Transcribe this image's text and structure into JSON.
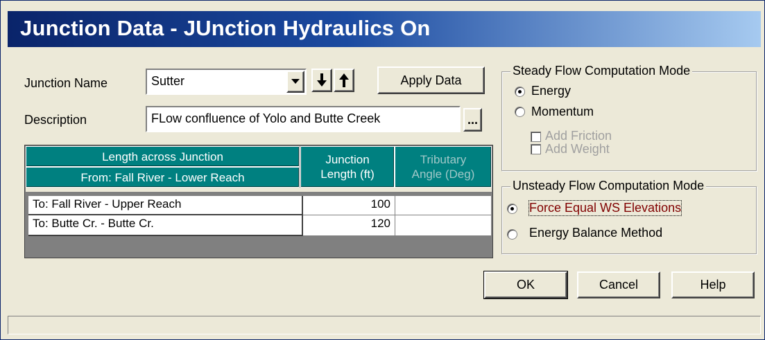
{
  "window": {
    "title": "Junction Data - JUnction Hydraulics On"
  },
  "junction": {
    "name_label": "Junction Name",
    "name_value": "Sutter",
    "description_label": "Description",
    "description_value": "FLow confluence of Yolo and Butte Creek",
    "browse_label": "...",
    "apply_label": "Apply Data",
    "down_icon": "arrow-down-icon",
    "up_icon": "arrow-up-icon"
  },
  "table": {
    "header_top": "Length across Junction",
    "header_from": "From: Fall River - Lower Reach",
    "header_length_line1": "Junction",
    "header_length_line2": "Length (ft)",
    "header_angle_line1": "Tributary",
    "header_angle_line2": "Angle (Deg)",
    "rows": [
      {
        "to": "To: Fall River - Upper Reach",
        "length": "100",
        "angle": ""
      },
      {
        "to": "To: Butte Cr. - Butte Cr.",
        "length": "120",
        "angle": ""
      }
    ]
  },
  "steady": {
    "title": "Steady Flow Computation Mode",
    "energy": "Energy",
    "momentum": "Momentum",
    "add_friction": "Add Friction",
    "add_weight": "Add Weight",
    "selected": "Energy"
  },
  "unsteady": {
    "title": "Unsteady Flow Computation Mode",
    "force_equal": "Force Equal WS Elevations",
    "energy_balance": "Energy Balance Method",
    "selected": "Force Equal WS Elevations",
    "selected_color": "#800000"
  },
  "buttons": {
    "ok": "OK",
    "cancel": "Cancel",
    "help": "Help"
  },
  "colors": {
    "header_teal": "#008080",
    "title_blue": "#0a246a",
    "disabled_text": "#a0a0a0"
  }
}
